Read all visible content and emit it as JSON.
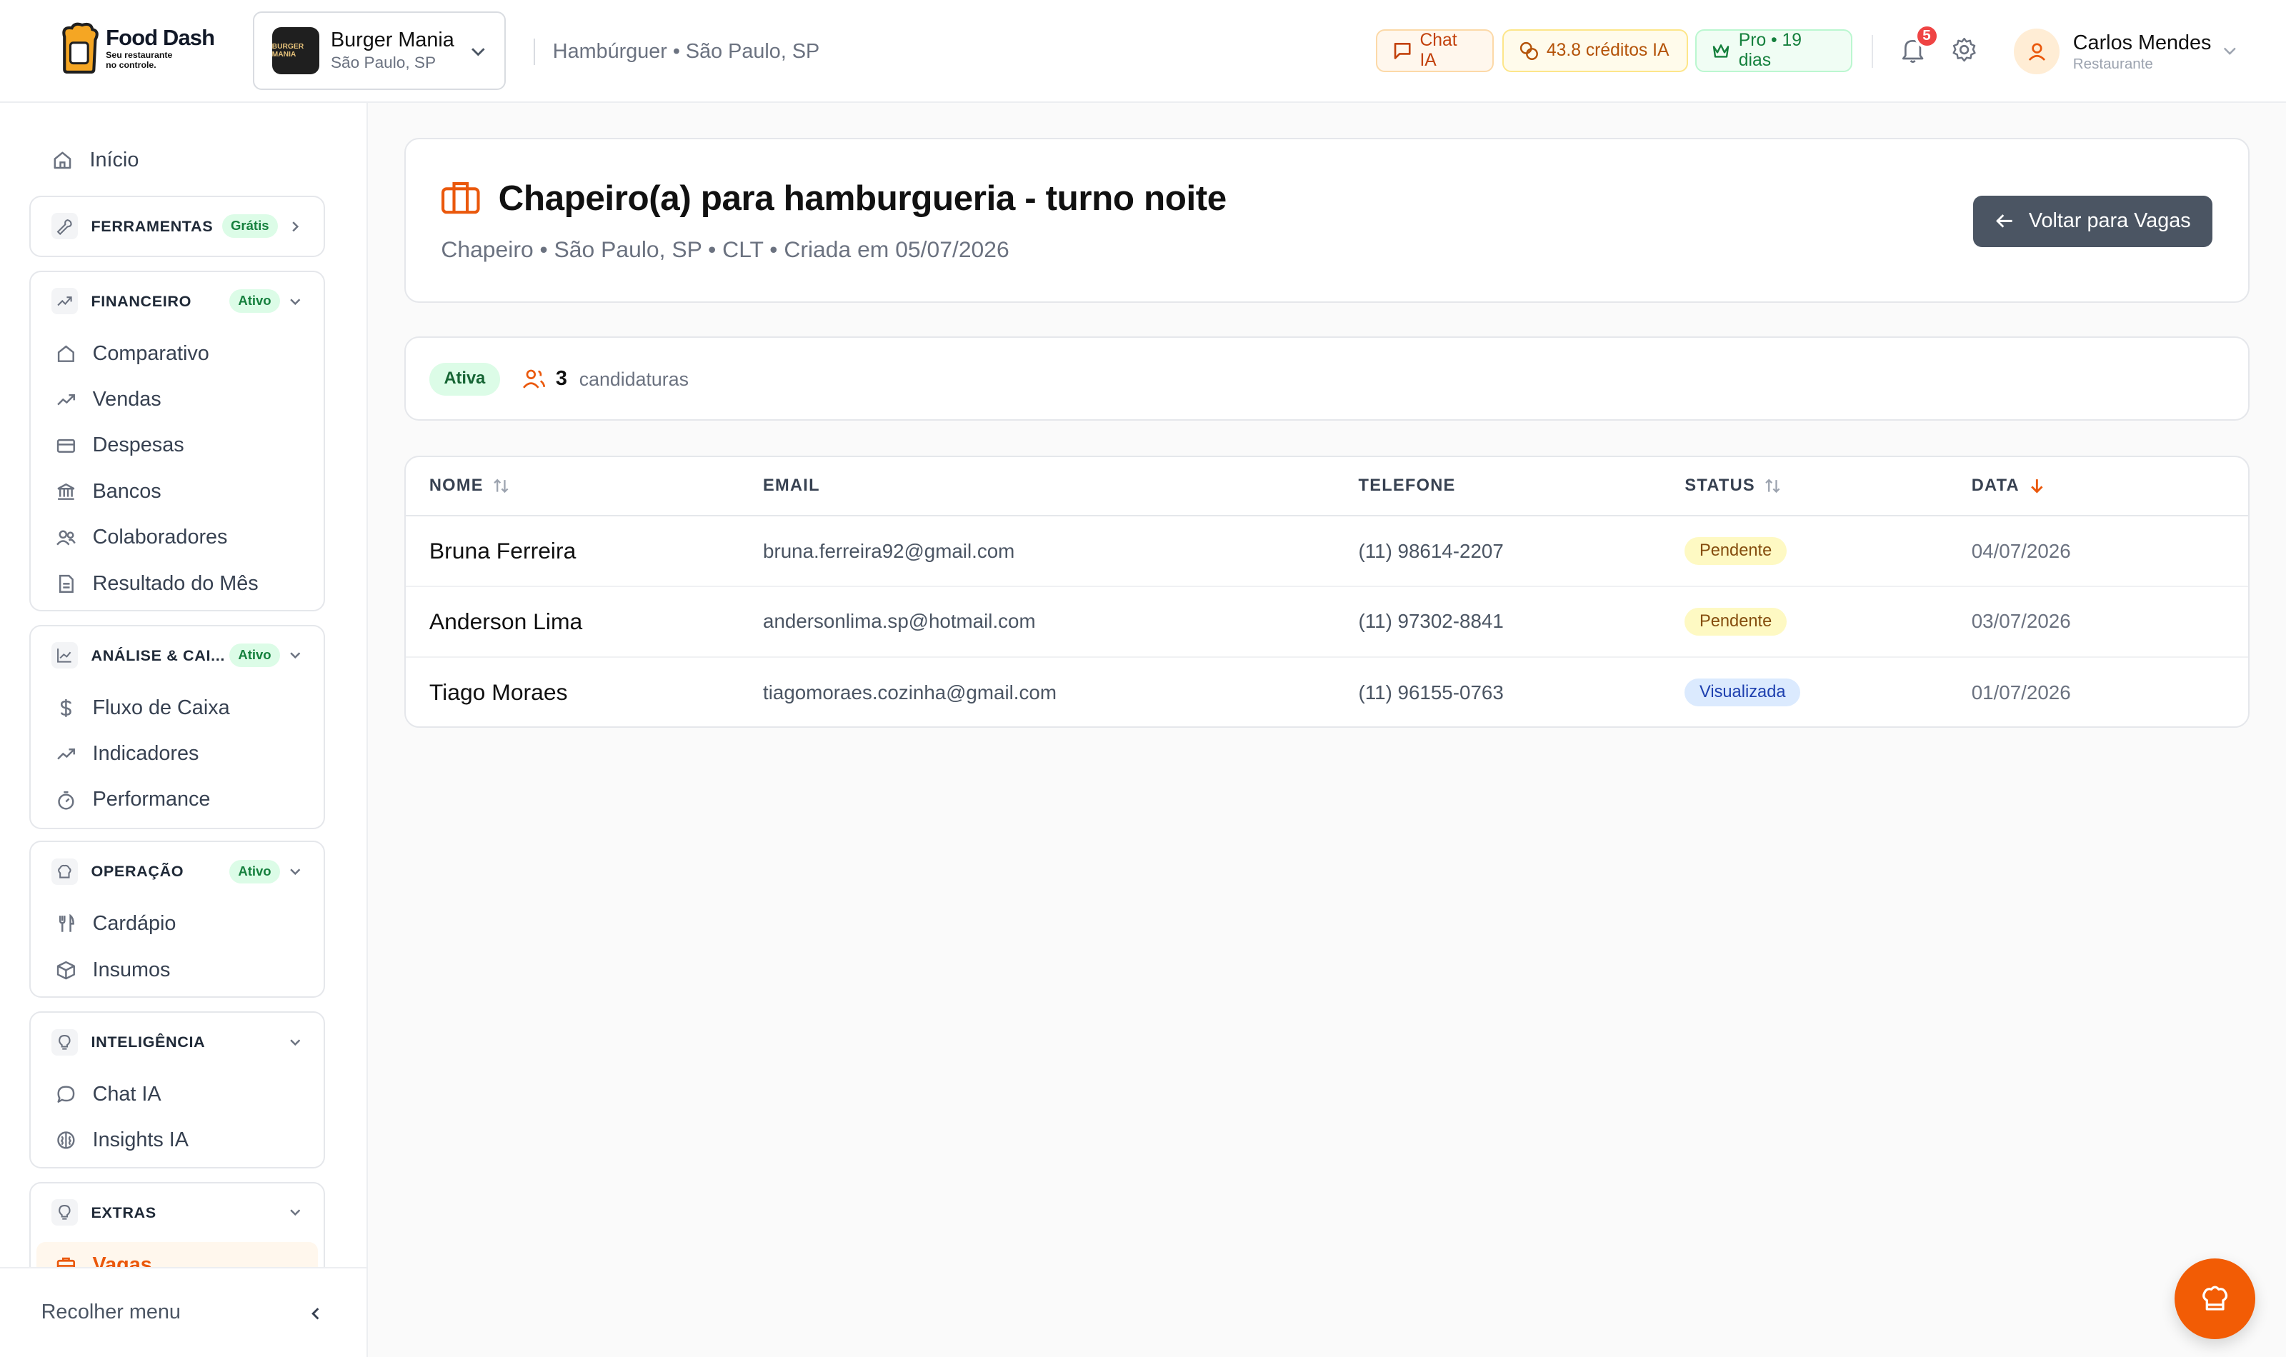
{
  "brand": {
    "name": "Food Dash",
    "tagline_1": "Seu restaurante",
    "tagline_2": "no controle.",
    "accent": "#f25c05"
  },
  "store": {
    "name": "Burger Mania",
    "location": "São Paulo, SP",
    "avatar_text": "BURGER MANIA"
  },
  "breadcrumb": "Hambúrguer • São Paulo, SP",
  "header": {
    "chat_label": "Chat IA",
    "credits_label": "43.8 créditos IA",
    "plan_label": "Pro • 19 dias",
    "notifications_count": "5",
    "user": {
      "name": "Carlos Mendes",
      "role": "Restaurante"
    }
  },
  "sidebar": {
    "home": "Início",
    "tools": {
      "label": "FERRAMENTAS",
      "badge": "Grátis"
    },
    "financeiro": {
      "label": "FINANCEIRO",
      "badge": "Ativo",
      "items": [
        "Comparativo",
        "Vendas",
        "Despesas",
        "Bancos",
        "Colaboradores",
        "Resultado do Mês"
      ]
    },
    "analise": {
      "label": "ANÁLISE & CAI...",
      "badge": "Ativo",
      "items": [
        "Fluxo de Caixa",
        "Indicadores",
        "Performance"
      ]
    },
    "operacao": {
      "label": "OPERAÇÃO",
      "badge": "Ativo",
      "items": [
        "Cardápio",
        "Insumos"
      ]
    },
    "inteligencia": {
      "label": "INTELIGÊNCIA",
      "items": [
        "Chat IA",
        "Insights IA"
      ]
    },
    "extras": {
      "label": "EXTRAS",
      "items": [
        "Vagas"
      ]
    },
    "collapse_label": "Recolher menu"
  },
  "job": {
    "title": "Chapeiro(a) para hamburgueria - turno noite",
    "meta": "Chapeiro • São Paulo, SP • CLT • Criada em 05/07/2026",
    "back_label": "Voltar para Vagas",
    "status": "Ativa",
    "applications_count": "3",
    "applications_label": "candidaturas"
  },
  "table": {
    "columns": [
      "NOME",
      "EMAIL",
      "TELEFONE",
      "STATUS",
      "DATA"
    ],
    "rows": [
      {
        "name": "Bruna Ferreira",
        "email": "bruna.ferreira92@gmail.com",
        "phone": "(11) 98614-2207",
        "status": "Pendente",
        "date": "04/07/2026"
      },
      {
        "name": "Anderson Lima",
        "email": "andersonlima.sp@hotmail.com",
        "phone": "(11) 97302-8841",
        "status": "Pendente",
        "date": "03/07/2026"
      },
      {
        "name": "Tiago Moraes",
        "email": "tiagomoraes.cozinha@gmail.com",
        "phone": "(11) 96155-0763",
        "status": "Visualizada",
        "date": "01/07/2026"
      }
    ]
  }
}
